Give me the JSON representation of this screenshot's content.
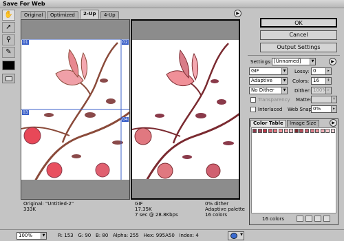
{
  "window": {
    "title": "Save For Web"
  },
  "tabs": [
    {
      "label": "Original",
      "active": false
    },
    {
      "label": "Optimized",
      "active": false
    },
    {
      "label": "2-Up",
      "active": true
    },
    {
      "label": "4-Up",
      "active": false
    }
  ],
  "tools": [
    "hand-tool-icon",
    "slice-select-tool-icon",
    "zoom-tool-icon",
    "eyedropper-tool-icon"
  ],
  "slices": {
    "s01": "01",
    "s02": "02",
    "s03": "03",
    "s04": "04"
  },
  "left_pane": {
    "line1": "Original: \"Untitled-2\"",
    "line2": "333K"
  },
  "right_pane": {
    "left_line1": "GIF",
    "left_line2": "17.35K",
    "left_line3": "7 sec @ 28.8Kbps",
    "right_line1": "0% dither",
    "right_line2": "Adaptive palette",
    "right_line3": "16 colors"
  },
  "buttons": {
    "ok": "OK",
    "cancel": "Cancel",
    "output_settings": "Output Settings"
  },
  "settings": {
    "settings_label": "Settings:",
    "settings_value": "[Unnamed]",
    "format": "GIF",
    "lossy_label": "Lossy:",
    "lossy_value": "0",
    "palette": "Adaptive",
    "colors_label": "Colors:",
    "colors_value": "16",
    "dither_algo": "No Dither",
    "dither_label": "Dither:",
    "dither_value": "100%",
    "transparency_label": "Transparency",
    "matte_label": "Matte:",
    "interlaced_label": "Interlaced",
    "websnap_label": "Web Snap:",
    "websnap_value": "0%"
  },
  "color_table": {
    "tab_label": "Color Table",
    "image_size_tab": "Image Size",
    "swatches": [
      "#8a3a4a",
      "#a8485c",
      "#c03848",
      "#d06070",
      "#e07880",
      "#f09098",
      "#f4a8b0",
      "#f0c0c8",
      "#7a2a30",
      "#b04c58",
      "#c86474",
      "#d87c88",
      "#e8949c",
      "#ecacb4",
      "#f6c8cc",
      "#f0d8dc"
    ],
    "count_label": "16 colors"
  },
  "status": {
    "zoom": "100%",
    "r_label": "R:",
    "r_value": "153",
    "g_label": "G:",
    "g_value": "90",
    "b_label": "B:",
    "b_value": "80",
    "alpha_label": "Alpha:",
    "alpha_value": "255",
    "hex_label": "Hex:",
    "hex_value": "995A50",
    "index_label": "Index:",
    "index_value": "4"
  },
  "colors": {
    "slice_blue": "#3a5fc8",
    "bg": "#c4c4c4"
  }
}
